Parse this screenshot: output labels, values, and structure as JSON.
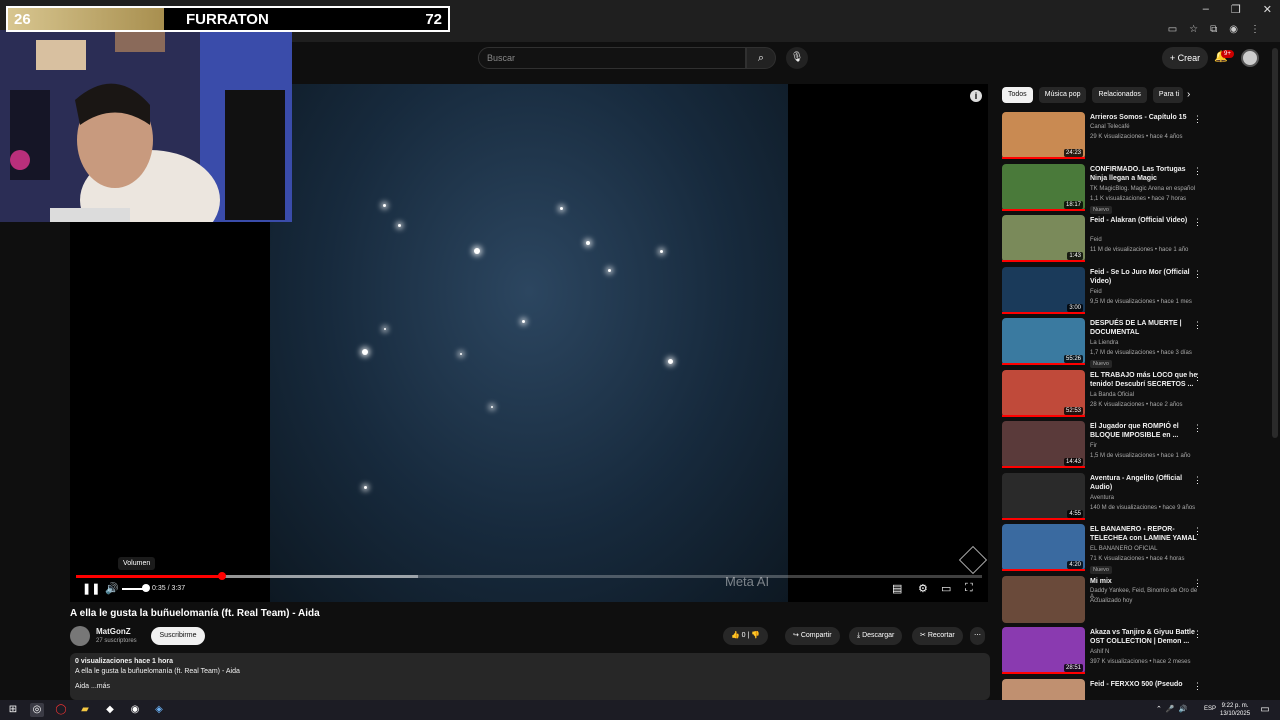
{
  "overlay": {
    "score_left": "26",
    "name": "FURRATON",
    "score_right": "72"
  },
  "header": {
    "search_placeholder": "Buscar",
    "create_label": "Crear",
    "notif_count": "9+"
  },
  "player": {
    "tooltip": "Volumen",
    "time": "0:35 / 3:37",
    "progress_played": 0.161,
    "watermark": "Meta AI"
  },
  "video": {
    "title": "A ella le gusta la buñuelomanía (ft. Real Team) - Aida",
    "channel": "MatGonZ",
    "subs": "27 suscriptores",
    "subscribe": "Suscribirme",
    "likes": "0",
    "share": "Compartir",
    "download": "Descargar",
    "clip": "Recortar",
    "desc_meta": "0 visualizaciones  hace 1 hora",
    "desc_line": "A ella le gusta la buñuelomanía (ft.  Real Team) - Aida",
    "desc_more": "Aida  ...más"
  },
  "chips": [
    "Todos",
    "Música pop",
    "Relacionados",
    "Para ti"
  ],
  "recs": [
    {
      "title": "Arrieros Somos - Capítulo 15",
      "channel": "Canal Telecafé",
      "meta": "29 K visualizaciones • hace 4 años",
      "dur": "24:23",
      "badge": "",
      "color": "#c98a52"
    },
    {
      "title": "CONFIRMADO. Las Tortugas Ninja llegan a Magic",
      "channel": "TK MagicBlog. Magic Arena en español",
      "meta": "1,1 K visualizaciones • hace 7 horas",
      "dur": "18:17",
      "badge": "Nuevo",
      "color": "#4a7a3a"
    },
    {
      "title": "Feid - Alakran (Official Video)",
      "channel": "Feid",
      "meta": "11 M de visualizaciones • hace 1 año",
      "dur": "1:43",
      "badge": "",
      "color": "#7a8a5a"
    },
    {
      "title": "Feid - Se Lo Juro Mor (Official Video)",
      "channel": "Feid",
      "meta": "9,5 M de visualizaciones • hace 1 mes",
      "dur": "3:00",
      "badge": "",
      "color": "#1a3a5a"
    },
    {
      "title": "DESPUÉS DE LA MUERTE | DOCUMENTAL",
      "channel": "La Liendra",
      "meta": "1,7 M de visualizaciones • hace 3 días",
      "dur": "55:26",
      "badge": "Nuevo",
      "color": "#3a7aa0"
    },
    {
      "title": "EL TRABAJO más LOCO que he tenido! Descubrí SECRETOS ...",
      "channel": "La Banda Oficial",
      "meta": "28 K visualizaciones • hace 2 años",
      "dur": "52:53",
      "badge": "",
      "color": "#c04a3a"
    },
    {
      "title": "El Jugador que ROMPIÓ el BLOQUE IMPOSIBLE en ...",
      "channel": "Fir",
      "meta": "1,5 M de visualizaciones • hace 1 año",
      "dur": "14:43",
      "badge": "",
      "color": "#5a3a3a"
    },
    {
      "title": "Aventura - Angelito (Official Audio)",
      "channel": "Aventura",
      "meta": "140 M de visualizaciones • hace 9 años",
      "dur": "4:55",
      "badge": "",
      "color": "#2a2a2a"
    },
    {
      "title": "EL BANANERO - REPOR-TELECHEA con LAMINE YAMAL",
      "channel": "EL BANANERO OFICIAL",
      "meta": "71 K visualizaciones • hace 4 horas",
      "dur": "4:20",
      "badge": "Nuevo",
      "color": "#3a6aa0"
    },
    {
      "title": "Mi mix",
      "channel": "Daddy Yankee, Feid, Binomio de Oro de A...",
      "meta": "Actualizado hoy",
      "dur": "",
      "badge": "",
      "color": "#6a4a3a"
    },
    {
      "title": "Akaza vs Tanjiro & Giyuu Battle OST COLLECTION | Demon ...",
      "channel": "Ashif N",
      "meta": "397 K visualizaciones • hace 2 meses",
      "dur": "28:51",
      "badge": "",
      "color": "#8a3ab0"
    },
    {
      "title": "Feid - FERXXO 500 (Pseudo",
      "channel": "",
      "meta": "",
      "dur": "",
      "badge": "",
      "color": "#c09070"
    }
  ],
  "taskbar": {
    "lang": "ESP",
    "time": "9:22 p. m.",
    "date": "13/10/2025"
  }
}
